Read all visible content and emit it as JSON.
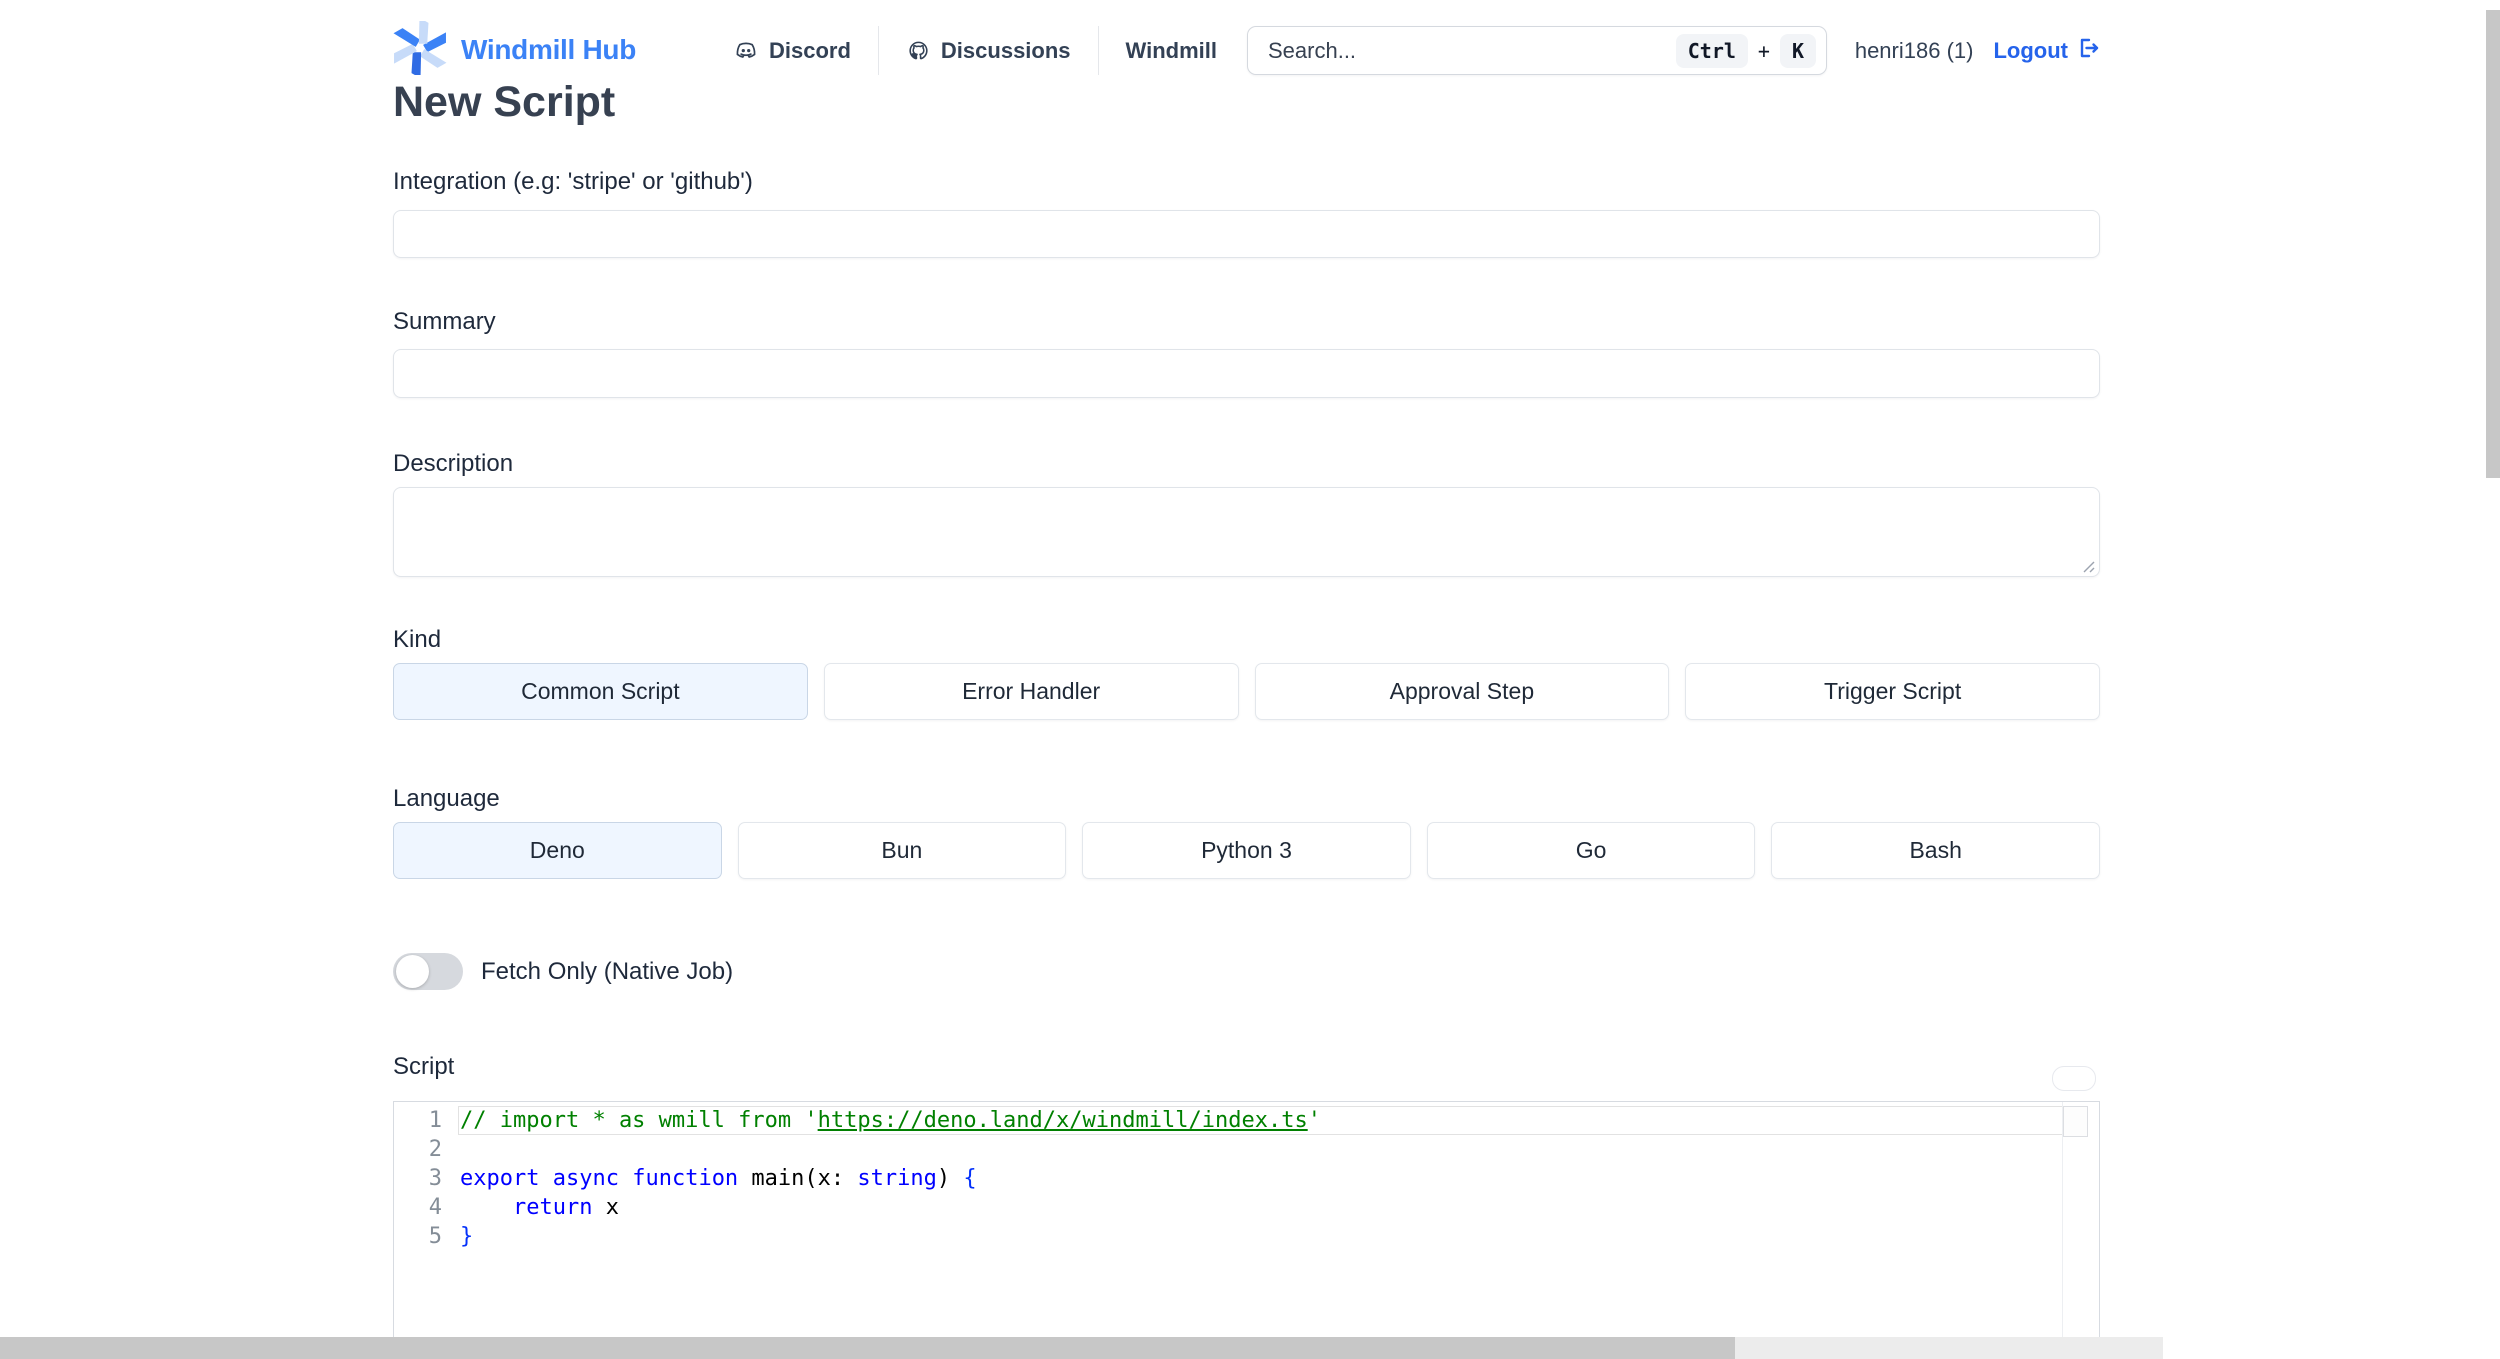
{
  "header": {
    "brand": "Windmill Hub",
    "nav": [
      {
        "label": "Discord",
        "icon": "discord-icon"
      },
      {
        "label": "Discussions",
        "icon": "github-icon"
      },
      {
        "label": "Windmill",
        "icon": ""
      }
    ],
    "search": {
      "placeholder": "Search...",
      "shortcut": {
        "keys": [
          "Ctrl",
          "K"
        ],
        "separator": "+"
      }
    },
    "user": {
      "name": "henri186 (1)",
      "logout": "Logout"
    }
  },
  "page": {
    "title": "New Script"
  },
  "form": {
    "integration": {
      "label": "Integration (e.g: 'stripe' or 'github')",
      "value": ""
    },
    "summary": {
      "label": "Summary",
      "value": ""
    },
    "description": {
      "label": "Description",
      "value": ""
    },
    "kind": {
      "label": "Kind",
      "options": [
        "Common Script",
        "Error Handler",
        "Approval Step",
        "Trigger Script"
      ],
      "selected": "Common Script"
    },
    "language": {
      "label": "Language",
      "options": [
        "Deno",
        "Bun",
        "Python 3",
        "Go",
        "Bash"
      ],
      "selected": "Deno"
    },
    "fetch_only": {
      "label": "Fetch Only (Native Job)",
      "enabled": false
    },
    "script": {
      "label": "Script"
    }
  },
  "editor": {
    "active_line": 1,
    "lines": [
      {
        "num": "1",
        "tokens": [
          {
            "t": "// import * as wmill from '",
            "s": "comment"
          },
          {
            "t": "https://deno.land/x/windmill/index.ts",
            "s": "comment-link"
          },
          {
            "t": "'",
            "s": "comment"
          }
        ]
      },
      {
        "num": "2",
        "tokens": []
      },
      {
        "num": "3",
        "tokens": [
          {
            "t": "export",
            "s": "keyword"
          },
          {
            "t": " ",
            "s": "plain"
          },
          {
            "t": "async",
            "s": "keyword"
          },
          {
            "t": " ",
            "s": "plain"
          },
          {
            "t": "function",
            "s": "keyword"
          },
          {
            "t": " main(x: ",
            "s": "plain"
          },
          {
            "t": "string",
            "s": "keyword"
          },
          {
            "t": ") ",
            "s": "plain"
          },
          {
            "t": "{",
            "s": "bracket"
          }
        ]
      },
      {
        "num": "4",
        "tokens": [
          {
            "t": "    ",
            "s": "plain"
          },
          {
            "t": "return",
            "s": "keyword"
          },
          {
            "t": " x",
            "s": "plain"
          }
        ]
      },
      {
        "num": "5",
        "tokens": [
          {
            "t": "}",
            "s": "bracket"
          }
        ]
      }
    ]
  },
  "colors": {
    "brand_blue": "#3b82f6",
    "logo_light_blue": "#c7dbf9",
    "link_blue": "#2563eb",
    "selected_bg": "#eff6ff",
    "comment_green": "#008000",
    "keyword_blue": "#0000ff",
    "bracket_blue": "#0431fa",
    "scrollbar_gray": "#c7c7c7"
  }
}
